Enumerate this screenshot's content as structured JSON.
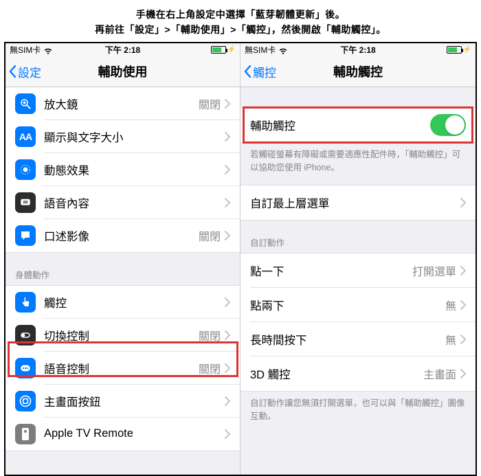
{
  "instructions": {
    "line1": "手機在右上角設定中選擇「藍芽韌體更新」後。",
    "line2": "再前往「設定」>「輔助使用」>「觸控」，然後開啟「輔助觸控」。"
  },
  "left": {
    "status": {
      "carrier": "無SIM卡",
      "time": "下午 2:18"
    },
    "nav": {
      "back": "設定",
      "title": "輔助使用"
    },
    "section_body_header": "身體動作",
    "rows": [
      {
        "icon": "magnifier",
        "bg": "#007aff",
        "label": "放大鏡",
        "detail": "關閉"
      },
      {
        "icon": "aa",
        "bg": "#007aff",
        "label": "顯示與文字大小",
        "detail": ""
      },
      {
        "icon": "motion",
        "bg": "#007aff",
        "label": "動態效果",
        "detail": ""
      },
      {
        "icon": "speech",
        "bg": "#2c2c2e",
        "label": "語音內容",
        "detail": ""
      },
      {
        "icon": "caption",
        "bg": "#007aff",
        "label": "口述影像",
        "detail": "關閉"
      },
      {
        "icon": "touch",
        "bg": "#007aff",
        "label": "觸控",
        "detail": ""
      },
      {
        "icon": "switch",
        "bg": "#2c2c2e",
        "label": "切換控制",
        "detail": "關閉"
      },
      {
        "icon": "voice",
        "bg": "#007aff",
        "label": "語音控制",
        "detail": "關閉"
      },
      {
        "icon": "home",
        "bg": "#007aff",
        "label": "主畫面按鈕",
        "detail": ""
      },
      {
        "icon": "tv",
        "bg": "#7d7d80",
        "label": "Apple TV Remote",
        "detail": ""
      }
    ]
  },
  "right": {
    "status": {
      "carrier": "無SIM卡",
      "time": "下午 2:18"
    },
    "nav": {
      "back": "觸控",
      "title": "輔助觸控"
    },
    "toggle_label": "輔助觸控",
    "toggle_footer": "若觸碰螢幕有障礙或需要適應性配件時，「輔助觸控」可以協助您使用 iPhone。",
    "custom_menu_label": "自訂最上層選單",
    "actions_header": "自訂動作",
    "actions": [
      {
        "label": "點一下",
        "detail": "打開選單"
      },
      {
        "label": "點兩下",
        "detail": "無"
      },
      {
        "label": "長時間按下",
        "detail": "無"
      },
      {
        "label": "3D 觸控",
        "detail": "主畫面"
      }
    ],
    "actions_footer": "自訂動作讓您無須打開選單，也可以與「輔助觸控」圖像互動。"
  }
}
